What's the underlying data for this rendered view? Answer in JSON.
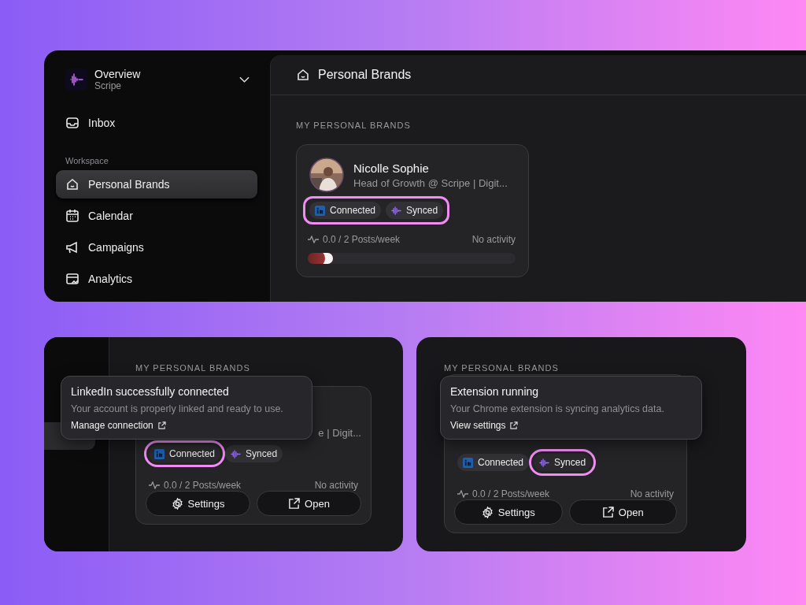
{
  "main_panel": {
    "workspace": {
      "name": "Overview",
      "org": "Scripe"
    },
    "sidebar": {
      "top_items": [
        {
          "label": "Inbox",
          "kind": "inbox",
          "selected": false
        }
      ],
      "section_label": "Workspace",
      "items": [
        {
          "label": "Personal Brands",
          "kind": "brand",
          "selected": true
        },
        {
          "label": "Calendar",
          "kind": "calendar",
          "selected": false
        },
        {
          "label": "Campaigns",
          "kind": "megaphone",
          "selected": false
        },
        {
          "label": "Analytics",
          "kind": "analytics",
          "selected": false
        }
      ]
    },
    "header_title": "Personal Brands",
    "section_title": "MY PERSONAL BRANDS",
    "card": {
      "name": "Nicolle Sophie",
      "subtitle": "Head of Growth @ Scripe | Digit...",
      "badges": [
        {
          "kind": "linkedin",
          "label": "Connected",
          "highlighted": true
        },
        {
          "kind": "synced",
          "label": "Synced",
          "highlighted": true
        }
      ],
      "posts": "0.0 / 2 Posts/week",
      "activity": "No activity",
      "level": 0.12
    }
  },
  "detail_panels": [
    {
      "section_title": "MY PERSONAL BRANDS",
      "sidebar_fragment": true,
      "tooltip": {
        "title": "LinkedIn successfully connected",
        "text": "Your account is properly linked and ready to use.",
        "link": "Manage connection"
      },
      "card": {
        "subtitle_fragment": "e | Digit...",
        "badges": [
          {
            "kind": "linkedin",
            "label": "Connected",
            "highlighted": true
          },
          {
            "kind": "synced",
            "label": "Synced",
            "highlighted": false
          }
        ],
        "posts": "0.0 / 2 Posts/week",
        "activity": "No activity",
        "buttons": [
          {
            "kind": "settings",
            "label": "Settings"
          },
          {
            "kind": "open",
            "label": "Open"
          }
        ]
      }
    },
    {
      "section_title": "MY PERSONAL BRANDS",
      "sidebar_fragment": false,
      "tooltip": {
        "title": "Extension running",
        "text": "Your Chrome extension is syncing analytics data.",
        "link": "View settings"
      },
      "card": {
        "badges": [
          {
            "kind": "linkedin",
            "label": "Connected",
            "highlighted": false
          },
          {
            "kind": "synced",
            "label": "Synced",
            "highlighted": true
          }
        ],
        "posts": "0.0 / 2 Posts/week",
        "activity": "No activity",
        "buttons": [
          {
            "kind": "settings",
            "label": "Settings"
          },
          {
            "kind": "open",
            "label": "Open"
          }
        ]
      }
    }
  ]
}
